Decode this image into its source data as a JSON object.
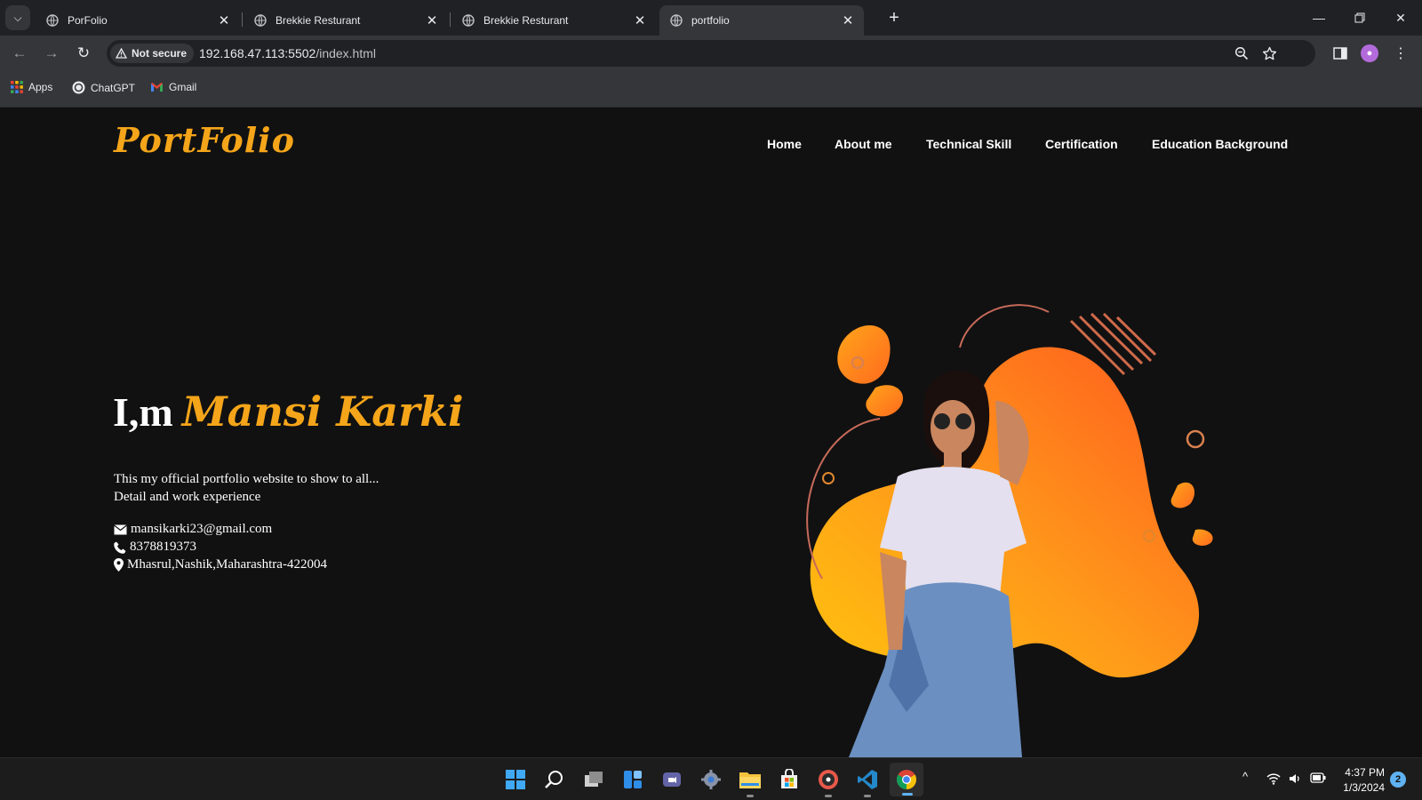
{
  "browser": {
    "tabs": [
      {
        "title": "PorFolio"
      },
      {
        "title": "Brekkie Resturant"
      },
      {
        "title": "Brekkie Resturant"
      },
      {
        "title": "portfolio"
      }
    ],
    "security_chip": "Not secure",
    "url_host": "192.168.47.113:5502",
    "url_path": "/index.html",
    "bookmarks": [
      {
        "label": "Apps"
      },
      {
        "label": "ChatGPT"
      },
      {
        "label": "Gmail"
      }
    ]
  },
  "site": {
    "logo": "PortFolio",
    "nav": [
      "Home",
      "About me",
      "Technical Skill",
      "Certification",
      "Education Background"
    ],
    "hero": {
      "greeting": "I,m",
      "name": "Mansi Karki",
      "line1": "This my official portfolio website to show to all...",
      "line2": "Detail and work experience",
      "email": "mansikarki23@gmail.com",
      "phone": "8378819373",
      "address": "Mhasrul,Nashik,Maharashtra-422004"
    }
  },
  "taskbar": {
    "time": "4:37 PM",
    "date": "1/3/2024",
    "notifications": "2"
  },
  "colors": {
    "accent": "#f5a51a",
    "page_bg": "#111111",
    "tab_bar": "#202124",
    "toolbar": "#35363a"
  }
}
